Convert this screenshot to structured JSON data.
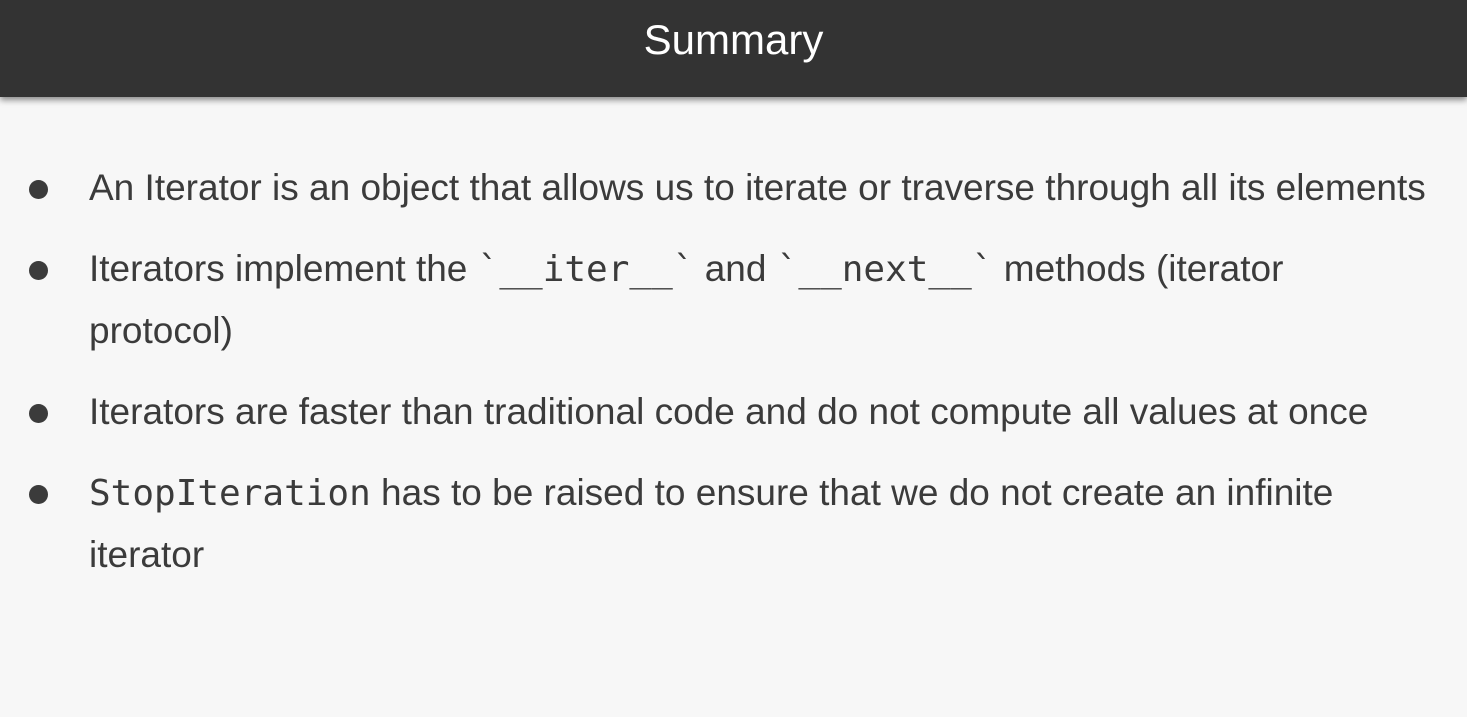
{
  "header": {
    "title": "Summary"
  },
  "bullets": [
    {
      "text": "An Iterator is an object that allows us to iterate or traverse through all its elements"
    },
    {
      "prefix": "Iterators implement the ",
      "code1": "`__iter__`",
      "middle": " and ",
      "code2": "`__next__`",
      "suffix": " methods (iterator protocol)"
    },
    {
      "text": "Iterators are faster than traditional code and do not compute all values at once"
    },
    {
      "code": "StopIteration",
      "suffix": " has to be raised to ensure that we do not create an infinite iterator"
    }
  ]
}
